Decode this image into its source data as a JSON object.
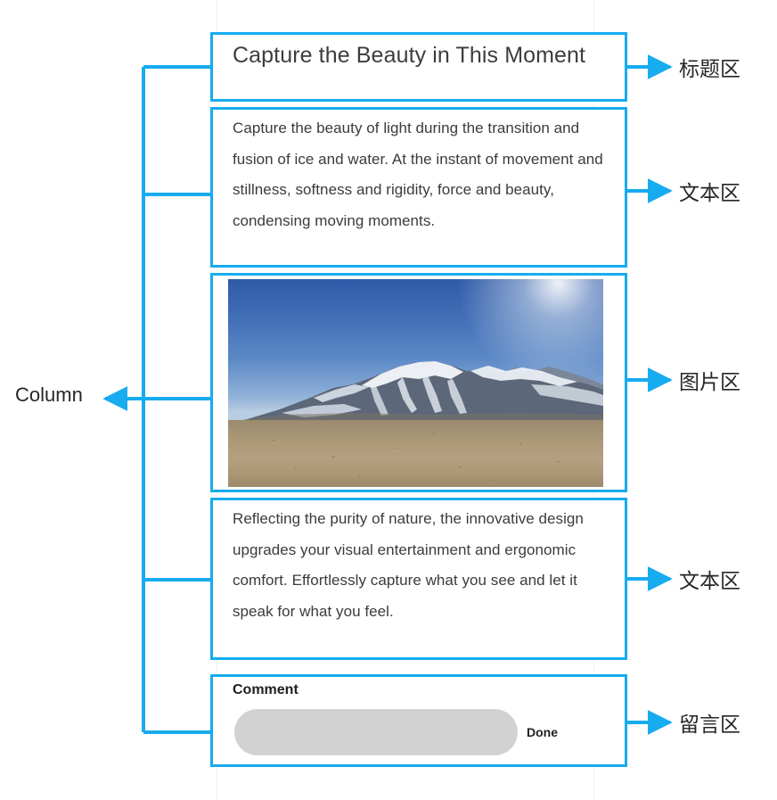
{
  "diagram": {
    "accent_color": "#17ABF0",
    "column_label": "Column",
    "guide_color": "#f0f0f0"
  },
  "screen": {
    "title_section": {
      "title": "Capture the Beauty in This Moment"
    },
    "text_section_1": {
      "body": "Capture the beauty of light during the transition and fusion of ice and water. At the instant of movement and stillness, softness and rigidity, force and beauty, condensing moving moments."
    },
    "image_section": {
      "alt": "Snow-capped mountain range under a clear blue sky with a tan plain in the foreground"
    },
    "text_section_2": {
      "body": "Reflecting the purity of nature, the innovative design upgrades your visual entertainment and ergonomic comfort. Effortlessly capture what you see and let it speak for what you feel."
    },
    "comment_section": {
      "label": "Comment",
      "input_value": "",
      "input_placeholder": "",
      "done_label": "Done"
    }
  },
  "annotations": {
    "title_area": "标题区",
    "text_area_1": "文本区",
    "image_area": "图片区",
    "text_area_2": "文本区",
    "comment_area": "留言区"
  }
}
